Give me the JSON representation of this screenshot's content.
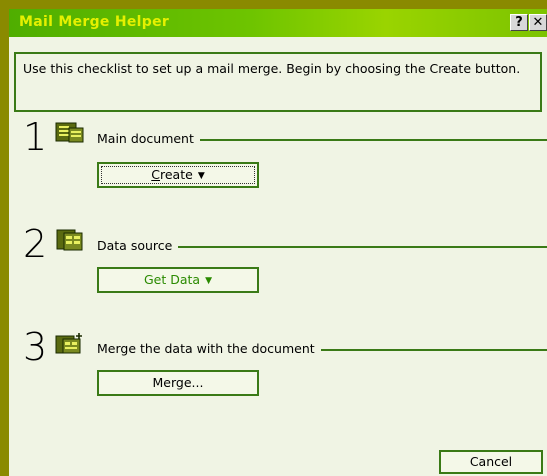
{
  "window": {
    "title": "Mail Merge Helper",
    "help_button": "?",
    "close_button": "✕"
  },
  "intro_text": "Use this checklist to set up a mail merge. Begin by choosing the Create button.",
  "steps": [
    {
      "number": "1",
      "icon": "main-document-icon",
      "label": "Main document",
      "button_label": "Create",
      "button_accel": "C",
      "button_rest": "reate",
      "button_has_arrow": true
    },
    {
      "number": "2",
      "icon": "data-source-icon",
      "label": "Data source",
      "button_label": "Get Data",
      "button_has_arrow": true
    },
    {
      "number": "3",
      "icon": "merge-icon",
      "label": "Merge the data with the document",
      "button_label": "Merge...",
      "button_has_arrow": false
    }
  ],
  "cancel_label": "Cancel",
  "colors": {
    "desktop": "#8a8a00",
    "titlebar": "#6ec400",
    "title_text": "#e5f000",
    "dialog_bg": "#f0f4e4",
    "accent_border": "#3a7a16",
    "green_text": "#2a8a00"
  }
}
